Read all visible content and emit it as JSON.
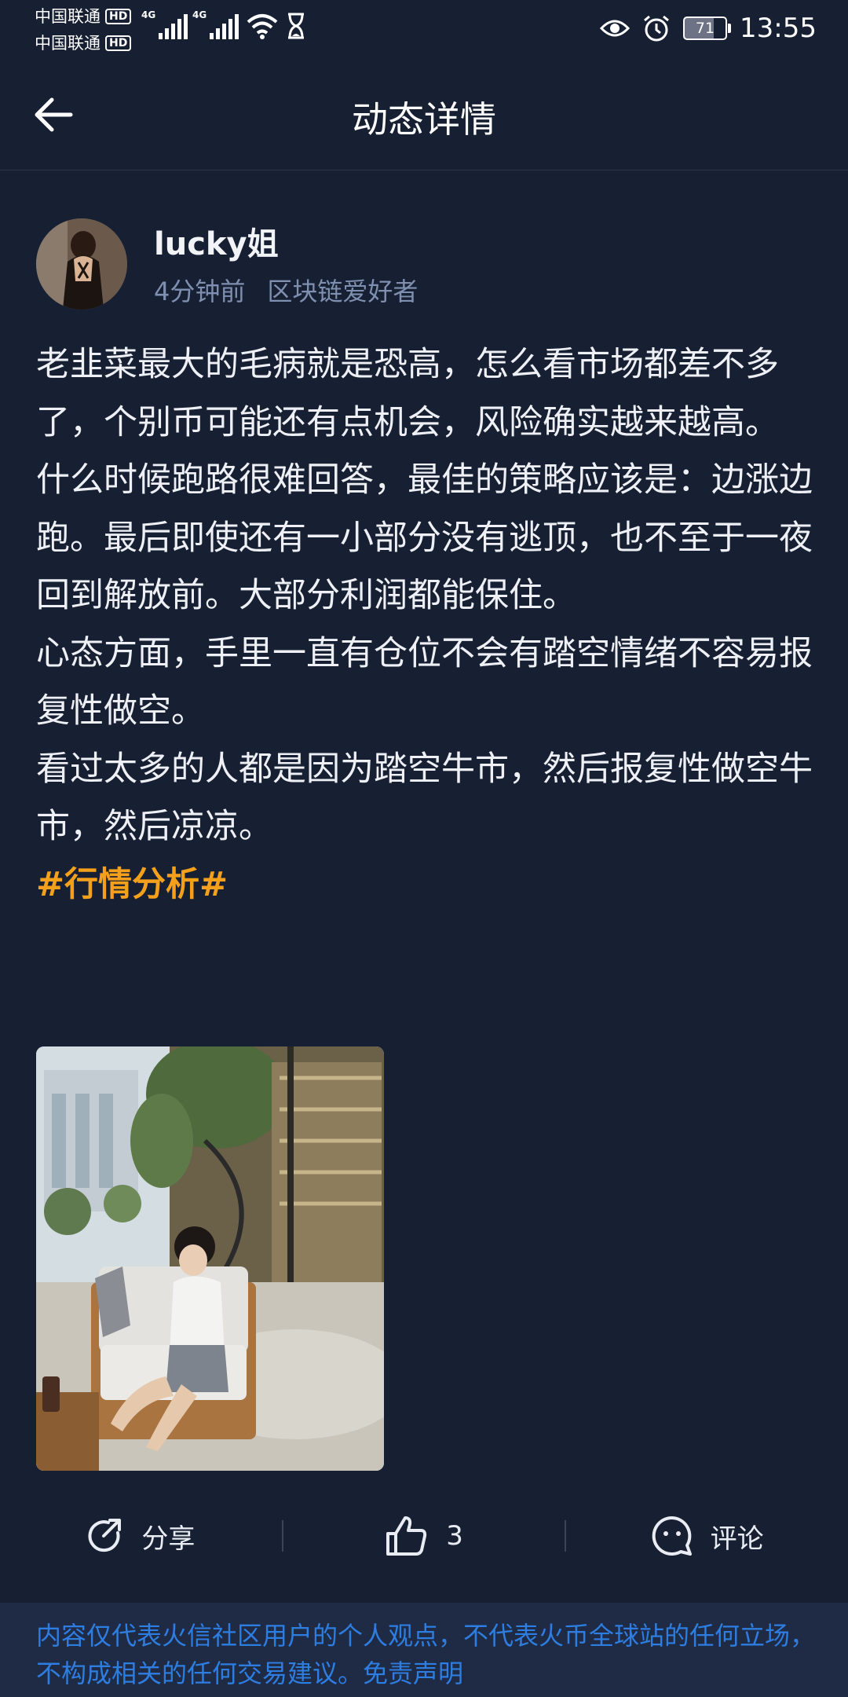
{
  "status_bar": {
    "carrier_1": "中国联通",
    "carrier_2": "中国联通",
    "hd_badge": "HD",
    "network_1": "4G",
    "network_2": "4G",
    "battery": "71",
    "time": "13:55"
  },
  "header": {
    "title": "动态详情"
  },
  "post": {
    "author_name": "lucky姐",
    "time_ago": "4分钟前",
    "author_tag": "区块链爱好者",
    "paragraphs": [
      "老韭菜最大的毛病就是恐高，怎么看市场都差不多了，个别币可能还有点机会，风险确实越来越高。",
      "什么时候跑路很难回答，最佳的策略应该是：边涨边跑。最后即使还有一小部分没有逃顶，也不至于一夜回到解放前。大部分利润都能保住。",
      "心态方面，手里一直有仓位不会有踏空情绪不容易报复性做空。",
      "看过太多的人都是因为踏空牛市，然后报复性做空牛市，然后凉凉。"
    ],
    "hashtag": "#行情分析#"
  },
  "actions": {
    "share_label": "分享",
    "like_count": "3",
    "comment_label": "评论"
  },
  "disclaimer": {
    "text": "内容仅代表火信社区用户的个人观点，不代表火币全球站的任何立场，不构成相关的任何交易建议。免责声明"
  },
  "colors": {
    "background": "#172033",
    "hashtag": "#f4a01b",
    "disclaimer_link": "#2e7de0",
    "meta_text": "#7f8fb0"
  }
}
